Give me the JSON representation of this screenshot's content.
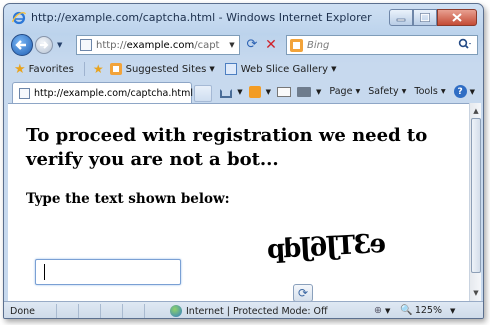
{
  "window": {
    "title": "http://example.com/captcha.html - Windows Internet Explorer"
  },
  "address_bar": {
    "url_prefix": "http://",
    "url_domain": "example.com",
    "url_rest": "/capt"
  },
  "search": {
    "placeholder": "Bing"
  },
  "favorites_bar": {
    "favorites_label": "Favorites",
    "suggested_sites_label": "Suggested Sites",
    "web_slice_gallery_label": "Web Slice Gallery"
  },
  "tab": {
    "label": "http://example.com/captcha.html"
  },
  "command_bar": {
    "page_label": "Page",
    "safety_label": "Safety",
    "tools_label": "Tools"
  },
  "content": {
    "heading": "To proceed with registration we need to verify you are not a bot...",
    "subheading": "Type the text shown below:",
    "captcha_text": "e3TJ6Jdp",
    "captcha_input_value": ""
  },
  "status_bar": {
    "status_text": "Done",
    "zone_text": "Internet | Protected Mode: Off",
    "zoom_text": "125%"
  },
  "icons": {
    "back": "back-arrow-icon",
    "forward": "forward-arrow-icon",
    "refresh": "refresh-icon",
    "stop": "stop-icon",
    "search": "search-icon",
    "home": "home-icon",
    "feeds": "feeds-icon",
    "mail": "mail-icon",
    "print": "print-icon",
    "help": "help-icon",
    "captcha_reload": "reload-icon"
  },
  "colors": {
    "frame": "#bcd3ec",
    "close_button": "#c44b35",
    "accent_orange": "#f2a33a",
    "input_focus": "#7aa0d4"
  }
}
